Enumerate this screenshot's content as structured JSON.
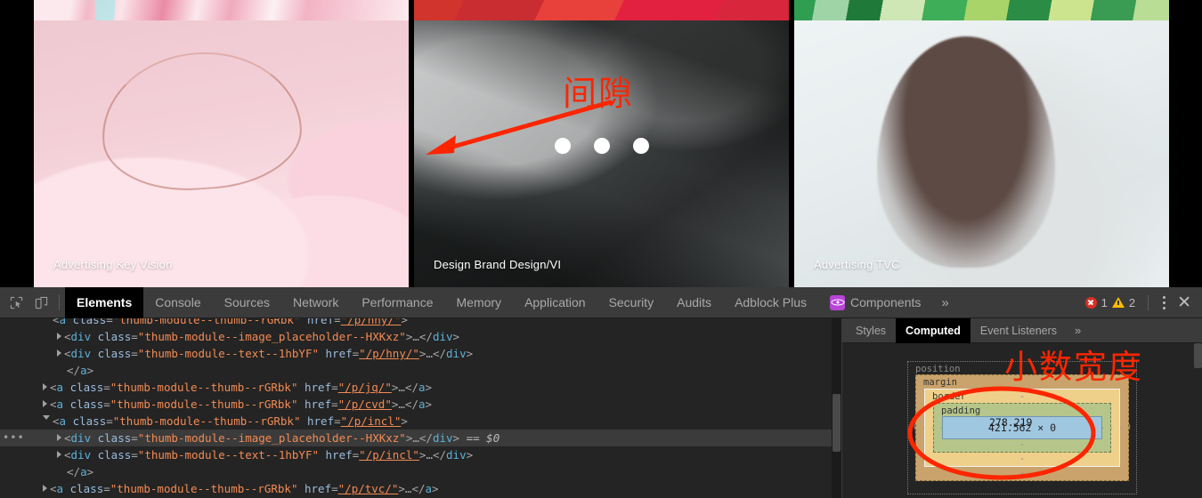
{
  "page": {
    "cards_top": [
      {
        "caption": "",
        "art": "art-paint-pink"
      },
      {
        "caption": "",
        "art": "art-paint-red"
      },
      {
        "caption": "",
        "art": "art-paint-green"
      }
    ],
    "cards_bottom": [
      {
        "caption": "Advertising Key Vision",
        "art": "art-jewelry"
      },
      {
        "caption": "Design Brand Design/VI",
        "art": "art-mountain"
      },
      {
        "caption": "Advertising TVC",
        "art": "art-portrait"
      }
    ],
    "carousel_dots": 3,
    "annotations": {
      "gap_label": "间隙",
      "decimal_width_label": "小数宽度",
      "annotation_color": "#fb2600"
    }
  },
  "devtools": {
    "toolbar_icons": [
      "inspect-element-icon",
      "device-toolbar-icon"
    ],
    "tabs": [
      {
        "label": "Elements",
        "active": true
      },
      {
        "label": "Console",
        "active": false
      },
      {
        "label": "Sources",
        "active": false
      },
      {
        "label": "Network",
        "active": false
      },
      {
        "label": "Performance",
        "active": false
      },
      {
        "label": "Memory",
        "active": false
      },
      {
        "label": "Application",
        "active": false
      },
      {
        "label": "Security",
        "active": false
      },
      {
        "label": "Audits",
        "active": false
      },
      {
        "label": "Adblock Plus",
        "active": false
      },
      {
        "label": "Components",
        "active": false,
        "badge": "react-icon"
      }
    ],
    "more_tabs_label": "»",
    "error_count": "1",
    "warning_count": "2",
    "close_label": "✕",
    "dom_rows": [
      {
        "indent": 3,
        "marker": "none",
        "selected": false,
        "clipped": true,
        "segments": [
          {
            "t": "punct",
            "s": "<"
          },
          {
            "t": "tag",
            "s": "a"
          },
          {
            "t": "attr",
            "s": " class"
          },
          {
            "t": "punct",
            "s": "="
          },
          {
            "t": "val",
            "s": "\"thumb-module--thumb--rGRbk\""
          },
          {
            "t": "attr",
            "s": " href"
          },
          {
            "t": "punct",
            "s": "="
          },
          {
            "t": "link",
            "s": "\"/p/hny/\""
          },
          {
            "t": "punct",
            "s": ">"
          }
        ]
      },
      {
        "indent": 4,
        "marker": "closed",
        "selected": false,
        "segments": [
          {
            "t": "punct",
            "s": "<"
          },
          {
            "t": "tag",
            "s": "div"
          },
          {
            "t": "attr",
            "s": " class"
          },
          {
            "t": "punct",
            "s": "="
          },
          {
            "t": "val",
            "s": "\"thumb-module--image_placeholder--HXKxz\""
          },
          {
            "t": "punct",
            "s": ">"
          },
          {
            "t": "ellip",
            "s": "…"
          },
          {
            "t": "punct",
            "s": "</"
          },
          {
            "t": "tag",
            "s": "div"
          },
          {
            "t": "punct",
            "s": ">"
          }
        ]
      },
      {
        "indent": 4,
        "marker": "closed",
        "selected": false,
        "segments": [
          {
            "t": "punct",
            "s": "<"
          },
          {
            "t": "tag",
            "s": "div"
          },
          {
            "t": "attr",
            "s": " class"
          },
          {
            "t": "punct",
            "s": "="
          },
          {
            "t": "val",
            "s": "\"thumb-module--text--1hbYF\""
          },
          {
            "t": "attr",
            "s": " href"
          },
          {
            "t": "punct",
            "s": "="
          },
          {
            "t": "link",
            "s": "\"/p/hny/\""
          },
          {
            "t": "punct",
            "s": ">"
          },
          {
            "t": "ellip",
            "s": "…"
          },
          {
            "t": "punct",
            "s": "</"
          },
          {
            "t": "tag",
            "s": "div"
          },
          {
            "t": "punct",
            "s": ">"
          }
        ]
      },
      {
        "indent": 4,
        "marker": "none",
        "selected": false,
        "segments": [
          {
            "t": "punct",
            "s": "</"
          },
          {
            "t": "tag",
            "s": "a"
          },
          {
            "t": "punct",
            "s": ">"
          }
        ]
      },
      {
        "indent": 3,
        "marker": "closed",
        "selected": false,
        "segments": [
          {
            "t": "punct",
            "s": "<"
          },
          {
            "t": "tag",
            "s": "a"
          },
          {
            "t": "attr",
            "s": " class"
          },
          {
            "t": "punct",
            "s": "="
          },
          {
            "t": "val",
            "s": "\"thumb-module--thumb--rGRbk\""
          },
          {
            "t": "attr",
            "s": " href"
          },
          {
            "t": "punct",
            "s": "="
          },
          {
            "t": "link",
            "s": "\"/p/jq/\""
          },
          {
            "t": "punct",
            "s": ">"
          },
          {
            "t": "ellip",
            "s": "…"
          },
          {
            "t": "punct",
            "s": "</"
          },
          {
            "t": "tag",
            "s": "a"
          },
          {
            "t": "punct",
            "s": ">"
          }
        ]
      },
      {
        "indent": 3,
        "marker": "closed",
        "selected": false,
        "segments": [
          {
            "t": "punct",
            "s": "<"
          },
          {
            "t": "tag",
            "s": "a"
          },
          {
            "t": "attr",
            "s": " class"
          },
          {
            "t": "punct",
            "s": "="
          },
          {
            "t": "val",
            "s": "\"thumb-module--thumb--rGRbk\""
          },
          {
            "t": "attr",
            "s": " href"
          },
          {
            "t": "punct",
            "s": "="
          },
          {
            "t": "link",
            "s": "\"/p/cvd\""
          },
          {
            "t": "punct",
            "s": ">"
          },
          {
            "t": "ellip",
            "s": "…"
          },
          {
            "t": "punct",
            "s": "</"
          },
          {
            "t": "tag",
            "s": "a"
          },
          {
            "t": "punct",
            "s": ">"
          }
        ]
      },
      {
        "indent": 3,
        "marker": "open",
        "selected": false,
        "segments": [
          {
            "t": "punct",
            "s": "<"
          },
          {
            "t": "tag",
            "s": "a"
          },
          {
            "t": "attr",
            "s": " class"
          },
          {
            "t": "punct",
            "s": "="
          },
          {
            "t": "val",
            "s": "\"thumb-module--thumb--rGRbk\""
          },
          {
            "t": "attr",
            "s": " href"
          },
          {
            "t": "punct",
            "s": "="
          },
          {
            "t": "link",
            "s": "\"/p/incl\""
          },
          {
            "t": "punct",
            "s": ">"
          }
        ]
      },
      {
        "indent": 4,
        "marker": "closed",
        "selected": true,
        "ellipsis_badge": "…",
        "segments": [
          {
            "t": "punct",
            "s": "<"
          },
          {
            "t": "tag",
            "s": "div"
          },
          {
            "t": "attr",
            "s": " class"
          },
          {
            "t": "punct",
            "s": "="
          },
          {
            "t": "val",
            "s": "\"thumb-module--image_placeholder--HXKxz\""
          },
          {
            "t": "punct",
            "s": ">"
          },
          {
            "t": "ellip",
            "s": "…"
          },
          {
            "t": "punct",
            "s": "</"
          },
          {
            "t": "tag",
            "s": "div"
          },
          {
            "t": "punct",
            "s": ">"
          },
          {
            "t": "dollar",
            "s": "  == $0"
          }
        ]
      },
      {
        "indent": 4,
        "marker": "closed",
        "selected": false,
        "segments": [
          {
            "t": "punct",
            "s": "<"
          },
          {
            "t": "tag",
            "s": "div"
          },
          {
            "t": "attr",
            "s": " class"
          },
          {
            "t": "punct",
            "s": "="
          },
          {
            "t": "val",
            "s": "\"thumb-module--text--1hbYF\""
          },
          {
            "t": "attr",
            "s": " href"
          },
          {
            "t": "punct",
            "s": "="
          },
          {
            "t": "link",
            "s": "\"/p/incl\""
          },
          {
            "t": "punct",
            "s": ">"
          },
          {
            "t": "ellip",
            "s": "…"
          },
          {
            "t": "punct",
            "s": "</"
          },
          {
            "t": "tag",
            "s": "div"
          },
          {
            "t": "punct",
            "s": ">"
          }
        ]
      },
      {
        "indent": 4,
        "marker": "none",
        "selected": false,
        "segments": [
          {
            "t": "punct",
            "s": "</"
          },
          {
            "t": "tag",
            "s": "a"
          },
          {
            "t": "punct",
            "s": ">"
          }
        ]
      },
      {
        "indent": 3,
        "marker": "closed",
        "selected": false,
        "segments": [
          {
            "t": "punct",
            "s": "<"
          },
          {
            "t": "tag",
            "s": "a"
          },
          {
            "t": "attr",
            "s": " class"
          },
          {
            "t": "punct",
            "s": "="
          },
          {
            "t": "val",
            "s": "\"thumb-module--thumb--rGRbk\""
          },
          {
            "t": "attr",
            "s": " href"
          },
          {
            "t": "punct",
            "s": "="
          },
          {
            "t": "link",
            "s": "\"/p/tvc/\""
          },
          {
            "t": "punct",
            "s": ">"
          },
          {
            "t": "ellip",
            "s": "…"
          },
          {
            "t": "punct",
            "s": "</"
          },
          {
            "t": "tag",
            "s": "a"
          },
          {
            "t": "punct",
            "s": ">"
          }
        ]
      }
    ],
    "sidebar": {
      "tabs": [
        {
          "label": "Styles",
          "active": false
        },
        {
          "label": "Computed",
          "active": true
        },
        {
          "label": "Event Listeners",
          "active": false
        }
      ],
      "more_label": "»",
      "box_model": {
        "position_label": "position",
        "position_left": "0",
        "position_right": "0",
        "margin_label": "margin",
        "margin_top": "-",
        "margin_right": "-",
        "margin_bottom": "-",
        "margin_left": "-",
        "border_label": "border",
        "border_top": "-",
        "border_right": "-",
        "border_bottom": "-",
        "border_left": "-",
        "padding_label": "padding",
        "padding_top": "-",
        "padding_right": "-",
        "padding_bottom": "-",
        "padding_left": "-",
        "content_size": "421.562 × 0",
        "tooltip": "278.219"
      }
    }
  }
}
